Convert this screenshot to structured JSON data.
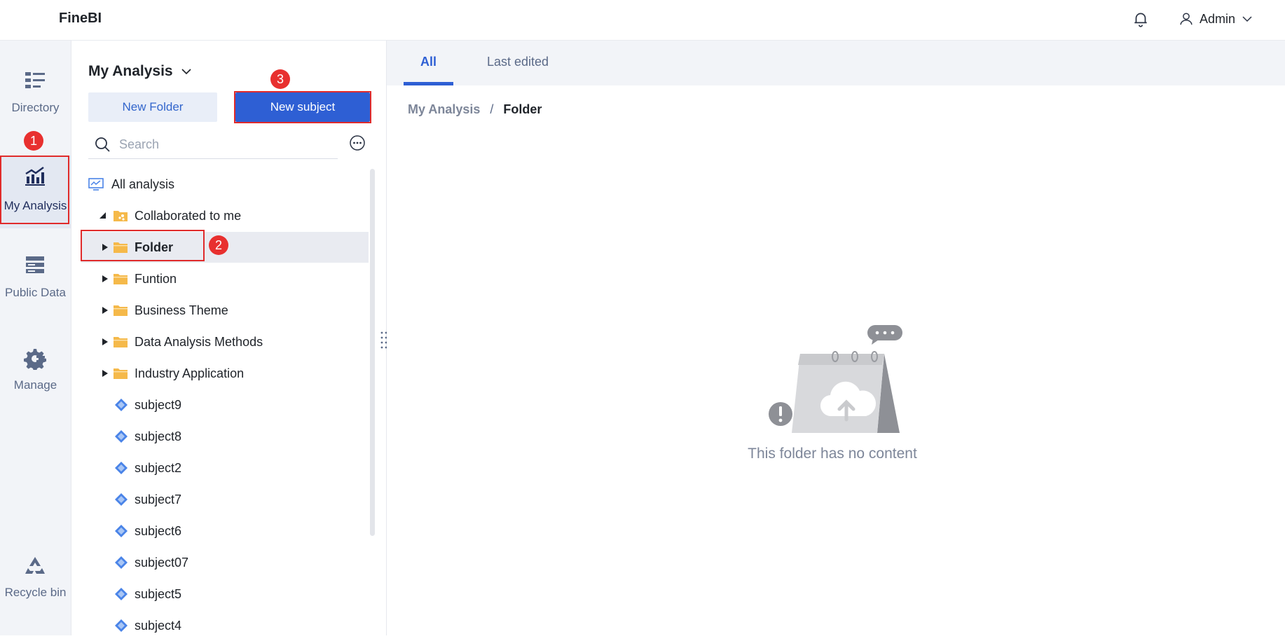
{
  "app": {
    "title": "FineBI"
  },
  "header": {
    "user_name": "Admin"
  },
  "leftnav": {
    "items": [
      {
        "label": "Directory",
        "icon": "list-icon"
      },
      {
        "label": "My Analysis",
        "icon": "chart-icon",
        "active": true
      },
      {
        "label": "Public Data",
        "icon": "database-icon"
      },
      {
        "label": "Manage",
        "icon": "gear-icon"
      },
      {
        "label": "Recycle bin",
        "icon": "recycle-icon"
      }
    ]
  },
  "markers": [
    "1",
    "2",
    "3"
  ],
  "panel": {
    "title": "My Analysis",
    "new_folder_label": "New Folder",
    "new_subject_label": "New subject",
    "search_placeholder": "Search",
    "tree": [
      {
        "label": "All analysis",
        "type": "root"
      },
      {
        "label": "Collaborated to me",
        "type": "shared-folder",
        "expanded": true
      },
      {
        "label": "Folder",
        "type": "folder",
        "selected": true
      },
      {
        "label": "Funtion",
        "type": "folder"
      },
      {
        "label": "Business Theme",
        "type": "folder"
      },
      {
        "label": "Data Analysis Methods",
        "type": "folder"
      },
      {
        "label": "Industry Application",
        "type": "folder"
      },
      {
        "label": "subject9",
        "type": "subject"
      },
      {
        "label": "subject8",
        "type": "subject"
      },
      {
        "label": "subject2",
        "type": "subject"
      },
      {
        "label": "subject7",
        "type": "subject"
      },
      {
        "label": "subject6",
        "type": "subject"
      },
      {
        "label": "subject07",
        "type": "subject"
      },
      {
        "label": "subject5",
        "type": "subject"
      },
      {
        "label": "subject4",
        "type": "subject"
      }
    ]
  },
  "main": {
    "tabs": [
      {
        "label": "All",
        "active": true
      },
      {
        "label": "Last edited"
      }
    ],
    "breadcrumb": {
      "parent": "My Analysis",
      "separator": "/",
      "current": "Folder"
    },
    "empty_text": "This folder has no content"
  },
  "colors": {
    "accent": "#2e5fd4",
    "marker": "#e8302f",
    "folder": "#f5b94a",
    "subject": "#4a84e8"
  }
}
